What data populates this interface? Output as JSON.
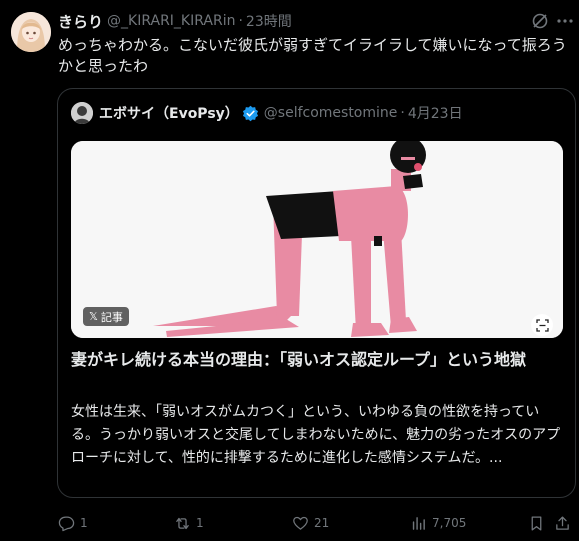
{
  "post": {
    "author_name": "きらり",
    "author_handle": "@_KIRARI_KIRARin",
    "separator": "·",
    "time": "23時間",
    "text": "めっちゃわかる。こないだ彼氏が弱すぎてイライラして嫌いになって振ろうかと思ったわ"
  },
  "quote": {
    "author_name": "エボサイ（EvoPsy）",
    "author_handle": "@selfcomestomine",
    "separator": "·",
    "date": "4月23日",
    "badge_label": "記事",
    "badge_logo": "𝕏",
    "title": "妻がキレ続ける本当の理由：「弱いオス認定ループ」という地獄",
    "description": "女性は生来、「弱いオスがムカつく」という、いわゆる負の性欲を持っている。うっかり弱いオスと交尾してしまわないために、魅力の劣ったオスのアプローチに対して、性的に排撃するために進化した感情システムだ。..."
  },
  "actions": {
    "replies": "1",
    "reposts": "1",
    "likes": "21",
    "views": "7,705"
  },
  "icons": {
    "grok": "grok-icon",
    "more": "more-icon",
    "verified": "verified-badge-icon",
    "reply": "reply-icon",
    "repost": "repost-icon",
    "like": "like-icon",
    "views": "views-icon",
    "bookmark": "bookmark-icon",
    "share": "share-icon",
    "scan": "scan-icon"
  },
  "colors": {
    "background": "#000000",
    "text": "#e7e9ea",
    "muted": "#71767b",
    "border": "#2f3336",
    "verified": "#1d9bf0",
    "figure_pink": "#e88ba3"
  }
}
